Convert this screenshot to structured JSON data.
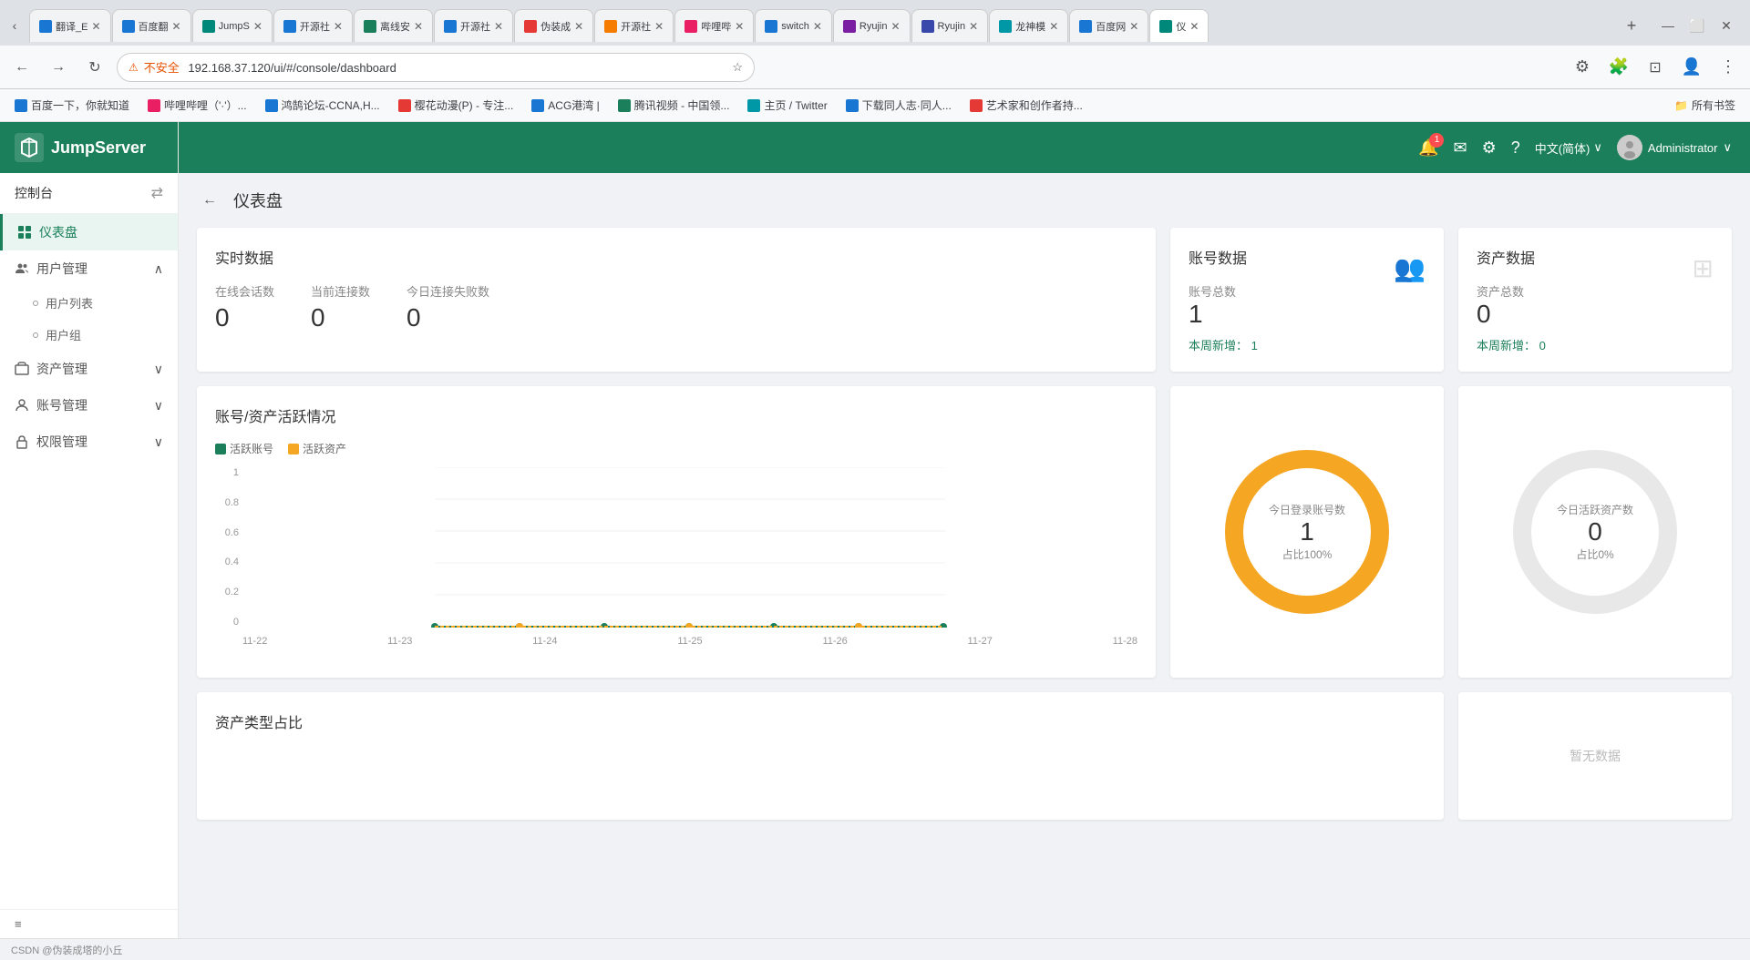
{
  "browser": {
    "tabs": [
      {
        "id": "t1",
        "label": "翻译_E",
        "color": "fav-blue",
        "active": false
      },
      {
        "id": "t2",
        "label": "百度翻",
        "color": "fav-blue",
        "active": false
      },
      {
        "id": "t3",
        "label": "JumpS",
        "color": "fav-teal",
        "active": false
      },
      {
        "id": "t4",
        "label": "开源社",
        "color": "fav-blue",
        "active": false
      },
      {
        "id": "t5",
        "label": "离线安",
        "color": "fav-green",
        "active": false
      },
      {
        "id": "t6",
        "label": "开源社",
        "color": "fav-blue",
        "active": false
      },
      {
        "id": "t7",
        "label": "伪装成",
        "color": "fav-red",
        "active": false
      },
      {
        "id": "t8",
        "label": "开源社",
        "color": "fav-orange",
        "active": false
      },
      {
        "id": "t9",
        "label": "哔哩哔",
        "color": "fav-pink",
        "active": false
      },
      {
        "id": "t10",
        "label": "switch",
        "color": "fav-blue",
        "active": false
      },
      {
        "id": "t11",
        "label": "Ryujin",
        "color": "fav-purple",
        "active": false
      },
      {
        "id": "t12",
        "label": "Ryujin",
        "color": "fav-indigo",
        "active": false
      },
      {
        "id": "t13",
        "label": "龙神模",
        "color": "fav-cyan",
        "active": false
      },
      {
        "id": "t14",
        "label": "百度网",
        "color": "fav-blue",
        "active": false
      },
      {
        "id": "t15",
        "label": "仪",
        "color": "fav-teal",
        "active": true
      }
    ],
    "url": "192.168.37.120/ui/#/console/dashboard",
    "url_prefix": "不安全",
    "bookmark_items": [
      {
        "label": "百度一下，你就知道",
        "color": "fav-blue"
      },
      {
        "label": "哔哩哔哩（'·'）...",
        "color": "fav-pink"
      },
      {
        "label": "鸿鹄论坛-CCNA,H...",
        "color": "fav-blue"
      },
      {
        "label": "樱花动漫(P) - 专注...",
        "color": "fav-red"
      },
      {
        "label": "ACG港湾 |",
        "color": "fav-blue"
      },
      {
        "label": "腾讯视频 - 中国领...",
        "color": "fav-green"
      },
      {
        "label": "主页 / Twitter",
        "color": "fav-cyan"
      },
      {
        "label": "下载同人志·同人...",
        "color": "fav-blue"
      },
      {
        "label": "艺术家和创作者持...",
        "color": "fav-red"
      }
    ]
  },
  "topbar": {
    "notification_count": "1",
    "language": "中文(简体)",
    "user": "Administrator"
  },
  "sidebar": {
    "control_title": "控制台",
    "items": [
      {
        "id": "dashboard",
        "label": "仪表盘",
        "active": true
      },
      {
        "id": "user-mgmt",
        "label": "用户管理",
        "expanded": true
      },
      {
        "id": "user-list",
        "label": "用户列表",
        "sub": true
      },
      {
        "id": "user-group",
        "label": "用户组",
        "sub": true
      },
      {
        "id": "asset-mgmt",
        "label": "资产管理",
        "expanded": false
      },
      {
        "id": "account-mgmt",
        "label": "账号管理",
        "expanded": false
      },
      {
        "id": "perm-mgmt",
        "label": "权限管理",
        "expanded": false
      }
    ]
  },
  "page": {
    "title": "仪表盘",
    "back_label": "←"
  },
  "realtime": {
    "section_title": "实时数据",
    "stats": [
      {
        "label": "在线会话数",
        "value": "0"
      },
      {
        "label": "当前连接数",
        "value": "0"
      },
      {
        "label": "今日连接失败数",
        "value": "0"
      }
    ]
  },
  "account_data": {
    "section_title": "账号数据",
    "total_label": "账号总数",
    "total_value": "1",
    "weekly_label": "本周新增：",
    "weekly_value": "1",
    "donut": {
      "center_label": "今日登录账号数",
      "center_value": "1",
      "center_sub": "占比100%",
      "fill_percent": 100,
      "color": "#f5a623"
    }
  },
  "asset_data": {
    "section_title": "资产数据",
    "total_label": "资产总数",
    "total_value": "0",
    "weekly_label": "本周新增：",
    "weekly_value": "0",
    "donut": {
      "center_label": "今日活跃资产数",
      "center_value": "0",
      "center_sub": "占比0%",
      "fill_percent": 0,
      "color": "#e0e0e0"
    }
  },
  "activity_chart": {
    "section_title": "账号/资产活跃情况",
    "legend_account": "活跃账号",
    "legend_asset": "活跃资产",
    "x_labels": [
      "11-22",
      "11-23",
      "11-24",
      "11-25",
      "11-26",
      "11-27",
      "11-28"
    ],
    "y_labels": [
      "0",
      "0.2",
      "0.4",
      "0.6",
      "0.8",
      "1"
    ],
    "account_color": "#1a7f5a",
    "asset_color": "#f5a623"
  },
  "asset_type": {
    "section_title": "资产类型占比",
    "no_data": "暂无数据"
  },
  "statusbar": {
    "text": "CSDN @伪装成塔的小丘"
  }
}
